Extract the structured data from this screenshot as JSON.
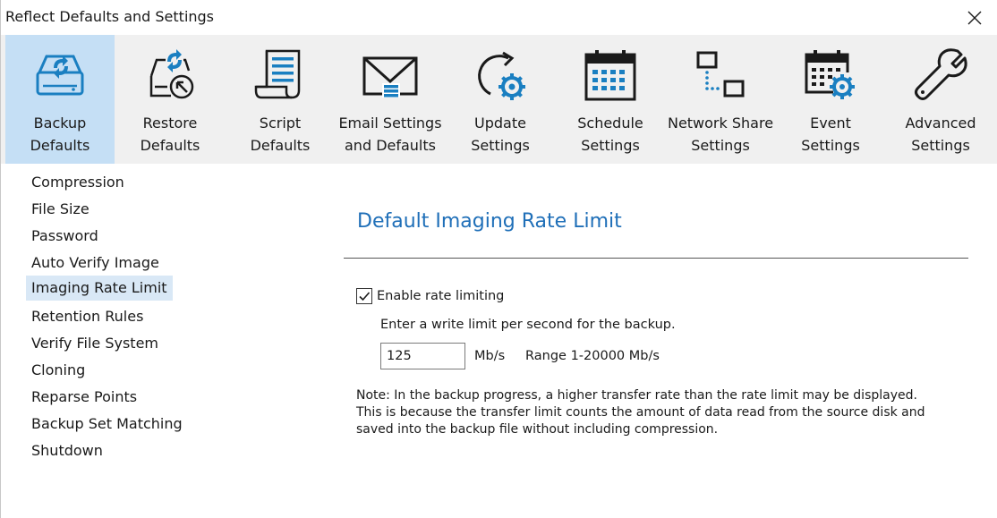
{
  "window": {
    "title": "Reflect Defaults and Settings",
    "close_icon": "close-icon"
  },
  "toolbar": {
    "items": [
      {
        "line1": "Backup",
        "line2": "Defaults",
        "icon": "backup-drive-icon",
        "active": true
      },
      {
        "line1": "Restore",
        "line2": "Defaults",
        "icon": "restore-icon",
        "active": false
      },
      {
        "line1": "Script",
        "line2": "Defaults",
        "icon": "script-icon",
        "active": false
      },
      {
        "line1": "Email Settings",
        "line2": "and Defaults",
        "icon": "email-icon",
        "active": false
      },
      {
        "line1": "Update",
        "line2": "Settings",
        "icon": "update-icon",
        "active": false
      },
      {
        "line1": "Schedule",
        "line2": "Settings",
        "icon": "schedule-icon",
        "active": false
      },
      {
        "line1": "Network Share",
        "line2": "Settings",
        "icon": "network-share-icon",
        "active": false
      },
      {
        "line1": "Event",
        "line2": "Settings",
        "icon": "event-icon",
        "active": false
      },
      {
        "line1": "Advanced",
        "line2": "Settings",
        "icon": "wrench-icon",
        "active": false
      }
    ]
  },
  "sidebar": {
    "items": [
      {
        "label": "Compression"
      },
      {
        "label": "File Size"
      },
      {
        "label": "Password"
      },
      {
        "label": "Auto Verify Image"
      },
      {
        "label": "Imaging Rate Limit",
        "selected": true
      },
      {
        "label": "Retention Rules"
      },
      {
        "label": "Verify File System"
      },
      {
        "label": "Cloning"
      },
      {
        "label": "Reparse Points"
      },
      {
        "label": "Backup Set Matching"
      },
      {
        "label": "Shutdown"
      }
    ]
  },
  "content": {
    "heading": "Default Imaging Rate Limit",
    "enable_label": "Enable rate limiting",
    "enable_checked": true,
    "hint": "Enter a write limit per second for the backup.",
    "limit_value": "125",
    "unit": "Mb/s",
    "range": "Range 1-20000 Mb/s",
    "note": "Note: In the backup progress, a higher transfer rate than the rate limit may be displayed. This is because the transfer limit counts the amount of data read from the source disk and saved into the backup file without including compression."
  },
  "colors": {
    "accent": "#1f6fb8",
    "active_tool_bg": "#c5dff5",
    "toolbar_bg": "#f0f0f0",
    "selected_nav_bg": "#d9e8f6"
  }
}
